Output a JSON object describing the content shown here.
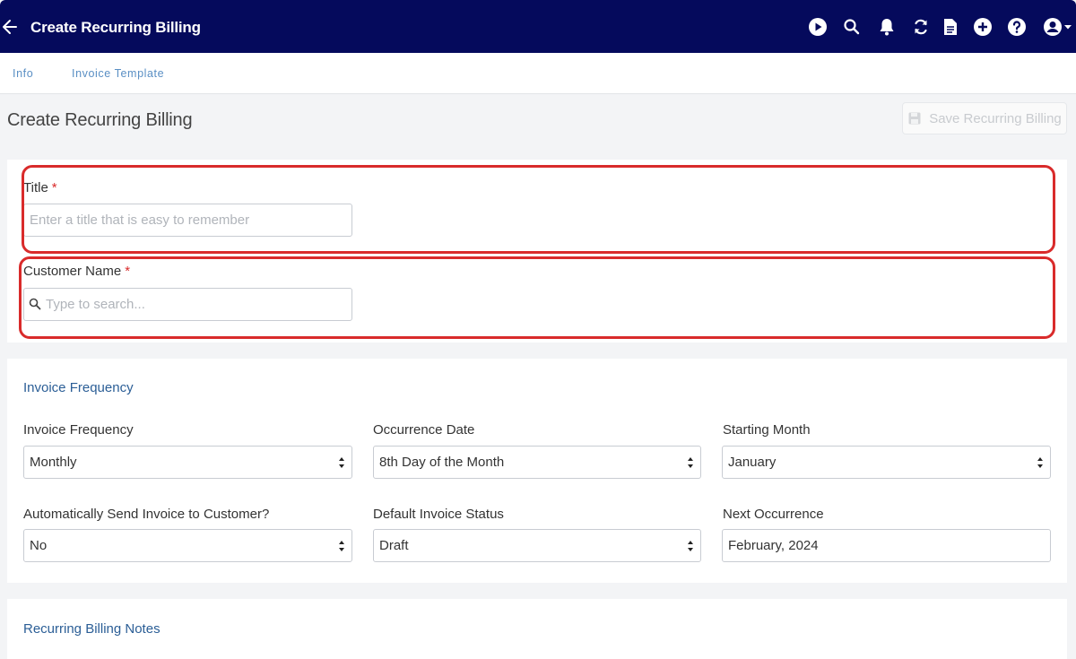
{
  "header": {
    "title": "Create Recurring Billing",
    "icons": [
      "back-arrow-icon",
      "play-icon",
      "search-icon",
      "bell-icon",
      "refresh-icon",
      "document-icon",
      "plus-icon",
      "help-icon",
      "user-icon"
    ]
  },
  "tabs": [
    {
      "label": "Info"
    },
    {
      "label": "Invoice Template"
    }
  ],
  "page": {
    "title": "Create Recurring Billing",
    "save_label": "Save Recurring Billing"
  },
  "form": {
    "title_label": "Title",
    "title_placeholder": "Enter a title that is easy to remember",
    "customer_label": "Customer Name",
    "customer_placeholder": "Type to search...",
    "required_mark": "*"
  },
  "frequency": {
    "section_title": "Invoice Frequency",
    "invoice_frequency_label": "Invoice Frequency",
    "invoice_frequency_value": "Monthly",
    "occurrence_date_label": "Occurrence Date",
    "occurrence_date_value": "8th Day of the Month",
    "starting_month_label": "Starting Month",
    "starting_month_value": "January",
    "auto_send_label": "Automatically Send Invoice to Customer?",
    "auto_send_value": "No",
    "default_status_label": "Default Invoice Status",
    "default_status_value": "Draft",
    "next_occurrence_label": "Next Occurrence",
    "next_occurrence_value": "February, 2024"
  },
  "notes": {
    "section_title": "Recurring Billing Notes"
  },
  "colors": {
    "header_bg": "#050a5c",
    "accent_link": "#5a8fc4",
    "section_title": "#2b5e96",
    "highlight": "#d92b2b"
  }
}
